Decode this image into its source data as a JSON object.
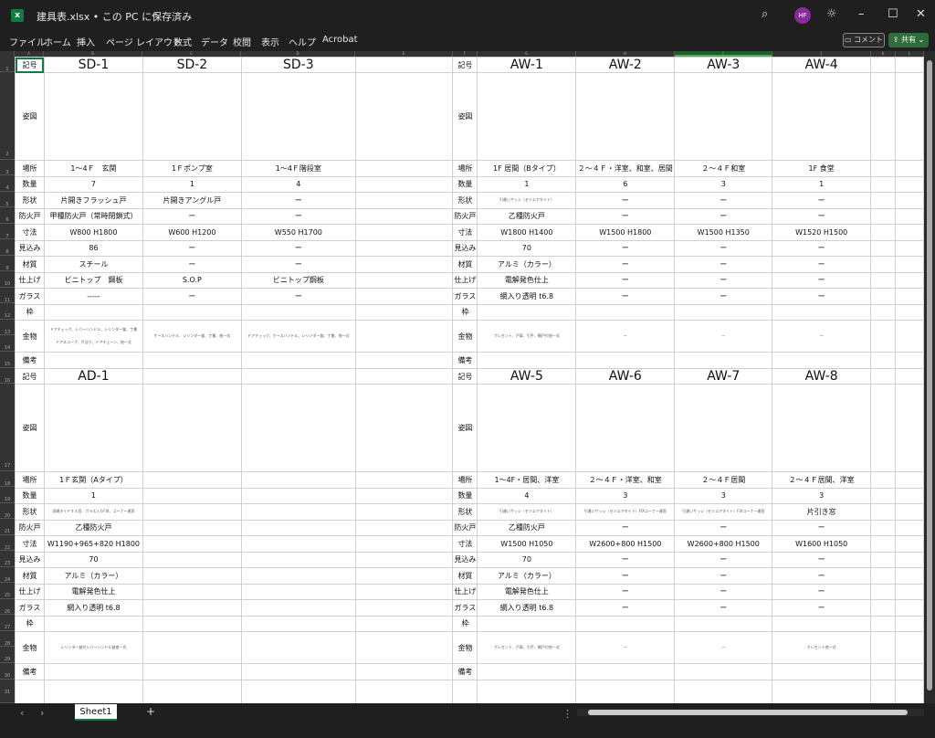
{
  "titlebar": {
    "filename": "建具表.xlsx",
    "saved_status": "この PC に保存済み",
    "avatar_initials": "HF"
  },
  "menu": [
    "ファイル",
    "ホーム",
    "挿入",
    "ページ レイアウト",
    "数式",
    "データ",
    "校閲",
    "表示",
    "ヘルプ",
    "Acrobat"
  ],
  "buttons": {
    "comment": "コメント",
    "share": "共有"
  },
  "columns": [
    "A",
    "B",
    "C",
    "D",
    "E",
    "F",
    "G",
    "H",
    "I",
    "J",
    "K",
    "L"
  ],
  "sheet": {
    "tab": "Sheet1"
  },
  "labels": [
    "記号",
    "姿図",
    "場所",
    "数量",
    "形状",
    "防火戸",
    "寸法",
    "見込み",
    "材質",
    "仕上げ",
    "ガラス",
    "枠",
    "金物",
    "備考"
  ],
  "block1": {
    "codes": [
      "SD-1",
      "SD-2",
      "SD-3",
      ""
    ],
    "place": [
      "1～4Ｆ　玄関",
      "1Ｆポンプ室",
      "1～4Ｆ階段室",
      ""
    ],
    "qty": [
      "7",
      "1",
      "4",
      ""
    ],
    "shape": [
      "片開きフラッシュ戸",
      "片開きアングル戸",
      "ー",
      ""
    ],
    "fire": [
      "甲種防火戸（常時閉鎖式）",
      "ー",
      "ー",
      ""
    ],
    "size": [
      "W800 H1800",
      "W600 H1200",
      "W550 H1700",
      ""
    ],
    "depth": [
      "86",
      "ー",
      "ー",
      ""
    ],
    "material": [
      "スチール",
      "ー",
      "ー",
      ""
    ],
    "finish": [
      "ビニトップ　鋼板",
      "S.O.P",
      "ビニトップ鋼板",
      ""
    ],
    "glass": [
      "-----",
      "ー",
      "ー",
      ""
    ],
    "hardware": [
      "ドアチェック、レバーハンドル、シリンダー錠、丁番",
      "ケースハンドル、シリンダー錠、丁番、他一式",
      "ドアチェック、ケースハンドル、シリンダー錠、丁番、他一式",
      ""
    ],
    "hardware2": [
      "ドアスコープ、戸当り、ドアチェーン、他一式",
      "",
      "",
      ""
    ]
  },
  "block2": {
    "codes": [
      "AW-1",
      "AW-2",
      "AW-3",
      "AW-4"
    ],
    "place": [
      "1F 居間（Bタイプ）",
      "２～４Ｆ・洋室、和室、居間",
      "２～４Ｆ和室",
      "1F 食堂"
    ],
    "qty": [
      "1",
      "6",
      "3",
      "1"
    ],
    "shape": [
      "引違いサッシ（セミエアタイト）",
      "ー",
      "ー",
      "ー"
    ],
    "fire": [
      "乙種防火戸",
      "ー",
      "ー",
      "ー"
    ],
    "size": [
      "W1800 H1400",
      "W1500 H1800",
      "W1500 H1350",
      "W1520 H1500"
    ],
    "depth": [
      "70",
      "ー",
      "ー",
      "ー"
    ],
    "material": [
      "アルミ（カラー）",
      "ー",
      "ー",
      "ー"
    ],
    "finish": [
      "電解発色仕上",
      "ー",
      "ー",
      "ー"
    ],
    "glass": [
      "網入り透明 t6.8",
      "ー",
      "ー",
      "ー"
    ],
    "hardware": [
      "クレセント、戸車、引手、網戸付他一式",
      "ー",
      "ー",
      "ー"
    ]
  },
  "block3": {
    "codes": [
      "AD-1",
      "",
      "",
      ""
    ],
    "place": [
      "1Ｆ玄関（Aタイプ）",
      "",
      "",
      ""
    ],
    "qty": [
      "1",
      "",
      "",
      ""
    ],
    "shape": [
      "両開き＋ＦＩＸ窓、ガラス入りFIX、コーナー連窓",
      "",
      "",
      ""
    ],
    "fire": [
      "乙種防火戸",
      "",
      "",
      ""
    ],
    "size": [
      "W1190+965+820 H1800",
      "",
      "",
      ""
    ],
    "depth": [
      "70",
      "",
      "",
      ""
    ],
    "material": [
      "アルミ（カラー）",
      "",
      "",
      ""
    ],
    "finish": [
      "電解発色仕上",
      "",
      "",
      ""
    ],
    "glass": [
      "網入り透明 t6.8",
      "",
      "",
      ""
    ],
    "hardware": [
      "シリンダー錠付レバーハンドル錠他一式",
      "",
      "",
      ""
    ]
  },
  "block4": {
    "codes": [
      "AW-5",
      "AW-6",
      "AW-7",
      "AW-8"
    ],
    "place": [
      "1～4F・居間、洋室",
      "２～４Ｆ・洋室、和室",
      "２～４Ｆ居間",
      "２～４Ｆ居間、洋室"
    ],
    "qty": [
      "4",
      "3",
      "3",
      "3"
    ],
    "shape": [
      "引違いサッシ（セミエアタイト）",
      "引違いサッシ（セミエアタイト）FIXコーナー連窓",
      "引違いサッシ（セミエアタイト）FIXコーナー連窓",
      "片引き窓"
    ],
    "fire": [
      "乙種防火戸",
      "ー",
      "ー",
      "ー"
    ],
    "size": [
      "W1500 H1050",
      "W2600+800 H1500",
      "W2600+800 H1500",
      "W1600 H1050"
    ],
    "depth": [
      "70",
      "ー",
      "ー",
      "ー"
    ],
    "material": [
      "アルミ（カラー）",
      "ー",
      "ー",
      "ー"
    ],
    "finish": [
      "電解発色仕上",
      "ー",
      "ー",
      "ー"
    ],
    "glass": [
      "網入り透明 t6.8",
      "ー",
      "ー",
      "ー"
    ],
    "hardware": [
      "クレセント、戸車、引手、網戸付他一式",
      "ー",
      "ー",
      "クレセント他一式"
    ]
  }
}
